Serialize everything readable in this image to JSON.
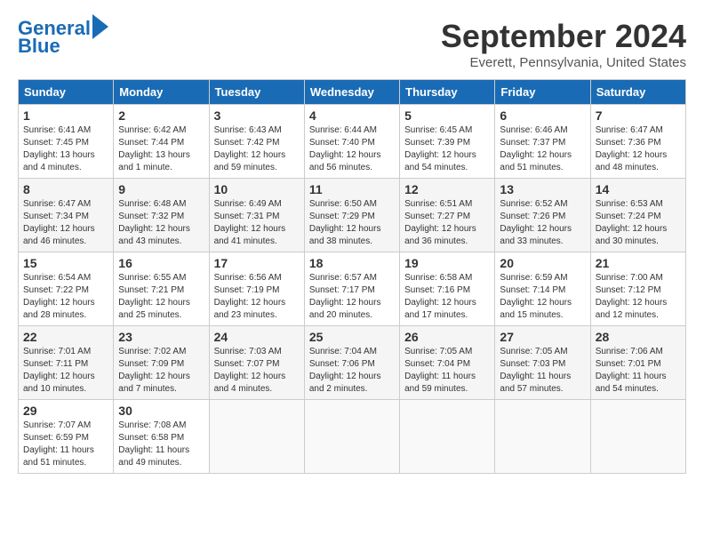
{
  "logo": {
    "line1": "General",
    "line2": "Blue"
  },
  "title": "September 2024",
  "location": "Everett, Pennsylvania, United States",
  "days_of_week": [
    "Sunday",
    "Monday",
    "Tuesday",
    "Wednesday",
    "Thursday",
    "Friday",
    "Saturday"
  ],
  "weeks": [
    [
      {
        "day": "1",
        "info": "Sunrise: 6:41 AM\nSunset: 7:45 PM\nDaylight: 13 hours\nand 4 minutes."
      },
      {
        "day": "2",
        "info": "Sunrise: 6:42 AM\nSunset: 7:44 PM\nDaylight: 13 hours\nand 1 minute."
      },
      {
        "day": "3",
        "info": "Sunrise: 6:43 AM\nSunset: 7:42 PM\nDaylight: 12 hours\nand 59 minutes."
      },
      {
        "day": "4",
        "info": "Sunrise: 6:44 AM\nSunset: 7:40 PM\nDaylight: 12 hours\nand 56 minutes."
      },
      {
        "day": "5",
        "info": "Sunrise: 6:45 AM\nSunset: 7:39 PM\nDaylight: 12 hours\nand 54 minutes."
      },
      {
        "day": "6",
        "info": "Sunrise: 6:46 AM\nSunset: 7:37 PM\nDaylight: 12 hours\nand 51 minutes."
      },
      {
        "day": "7",
        "info": "Sunrise: 6:47 AM\nSunset: 7:36 PM\nDaylight: 12 hours\nand 48 minutes."
      }
    ],
    [
      {
        "day": "8",
        "info": "Sunrise: 6:47 AM\nSunset: 7:34 PM\nDaylight: 12 hours\nand 46 minutes."
      },
      {
        "day": "9",
        "info": "Sunrise: 6:48 AM\nSunset: 7:32 PM\nDaylight: 12 hours\nand 43 minutes."
      },
      {
        "day": "10",
        "info": "Sunrise: 6:49 AM\nSunset: 7:31 PM\nDaylight: 12 hours\nand 41 minutes."
      },
      {
        "day": "11",
        "info": "Sunrise: 6:50 AM\nSunset: 7:29 PM\nDaylight: 12 hours\nand 38 minutes."
      },
      {
        "day": "12",
        "info": "Sunrise: 6:51 AM\nSunset: 7:27 PM\nDaylight: 12 hours\nand 36 minutes."
      },
      {
        "day": "13",
        "info": "Sunrise: 6:52 AM\nSunset: 7:26 PM\nDaylight: 12 hours\nand 33 minutes."
      },
      {
        "day": "14",
        "info": "Sunrise: 6:53 AM\nSunset: 7:24 PM\nDaylight: 12 hours\nand 30 minutes."
      }
    ],
    [
      {
        "day": "15",
        "info": "Sunrise: 6:54 AM\nSunset: 7:22 PM\nDaylight: 12 hours\nand 28 minutes."
      },
      {
        "day": "16",
        "info": "Sunrise: 6:55 AM\nSunset: 7:21 PM\nDaylight: 12 hours\nand 25 minutes."
      },
      {
        "day": "17",
        "info": "Sunrise: 6:56 AM\nSunset: 7:19 PM\nDaylight: 12 hours\nand 23 minutes."
      },
      {
        "day": "18",
        "info": "Sunrise: 6:57 AM\nSunset: 7:17 PM\nDaylight: 12 hours\nand 20 minutes."
      },
      {
        "day": "19",
        "info": "Sunrise: 6:58 AM\nSunset: 7:16 PM\nDaylight: 12 hours\nand 17 minutes."
      },
      {
        "day": "20",
        "info": "Sunrise: 6:59 AM\nSunset: 7:14 PM\nDaylight: 12 hours\nand 15 minutes."
      },
      {
        "day": "21",
        "info": "Sunrise: 7:00 AM\nSunset: 7:12 PM\nDaylight: 12 hours\nand 12 minutes."
      }
    ],
    [
      {
        "day": "22",
        "info": "Sunrise: 7:01 AM\nSunset: 7:11 PM\nDaylight: 12 hours\nand 10 minutes."
      },
      {
        "day": "23",
        "info": "Sunrise: 7:02 AM\nSunset: 7:09 PM\nDaylight: 12 hours\nand 7 minutes."
      },
      {
        "day": "24",
        "info": "Sunrise: 7:03 AM\nSunset: 7:07 PM\nDaylight: 12 hours\nand 4 minutes."
      },
      {
        "day": "25",
        "info": "Sunrise: 7:04 AM\nSunset: 7:06 PM\nDaylight: 12 hours\nand 2 minutes."
      },
      {
        "day": "26",
        "info": "Sunrise: 7:05 AM\nSunset: 7:04 PM\nDaylight: 11 hours\nand 59 minutes."
      },
      {
        "day": "27",
        "info": "Sunrise: 7:05 AM\nSunset: 7:03 PM\nDaylight: 11 hours\nand 57 minutes."
      },
      {
        "day": "28",
        "info": "Sunrise: 7:06 AM\nSunset: 7:01 PM\nDaylight: 11 hours\nand 54 minutes."
      }
    ],
    [
      {
        "day": "29",
        "info": "Sunrise: 7:07 AM\nSunset: 6:59 PM\nDaylight: 11 hours\nand 51 minutes."
      },
      {
        "day": "30",
        "info": "Sunrise: 7:08 AM\nSunset: 6:58 PM\nDaylight: 11 hours\nand 49 minutes."
      },
      {
        "day": "",
        "info": ""
      },
      {
        "day": "",
        "info": ""
      },
      {
        "day": "",
        "info": ""
      },
      {
        "day": "",
        "info": ""
      },
      {
        "day": "",
        "info": ""
      }
    ]
  ]
}
